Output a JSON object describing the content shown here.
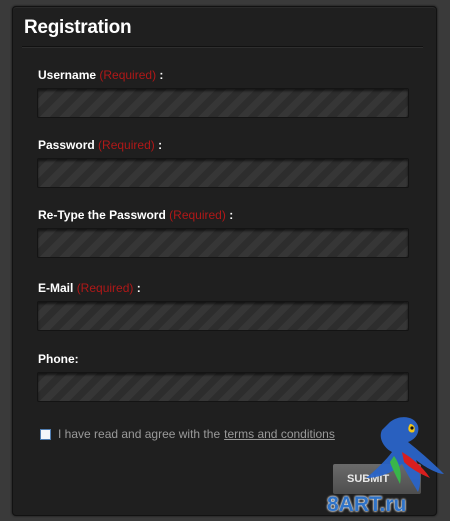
{
  "form": {
    "title": "Registration",
    "fields": [
      {
        "label": "Username",
        "required_text": "(Required)",
        "colon": ":",
        "value": ""
      },
      {
        "label": "Password",
        "required_text": "(Required)",
        "colon": ":",
        "value": ""
      },
      {
        "label": "Re-Type the Password",
        "required_text": "(Required)",
        "colon": ":",
        "value": ""
      },
      {
        "label": "E-Mail",
        "required_text": "(Required)",
        "colon": ":",
        "value": ""
      },
      {
        "label": "Phone:",
        "value": ""
      }
    ],
    "agree_text": "I have read and agree with the",
    "terms_link": "terms and conditions",
    "agree_checked": false,
    "submit_label": "SUBMIT"
  },
  "watermark": {
    "text": "8ART.ru",
    "icon": "parrot-icon"
  },
  "colors": {
    "background": "#3a3a3a",
    "panel": "#1f1f1f",
    "required": "#b01818",
    "link": "#9a9a9a"
  }
}
